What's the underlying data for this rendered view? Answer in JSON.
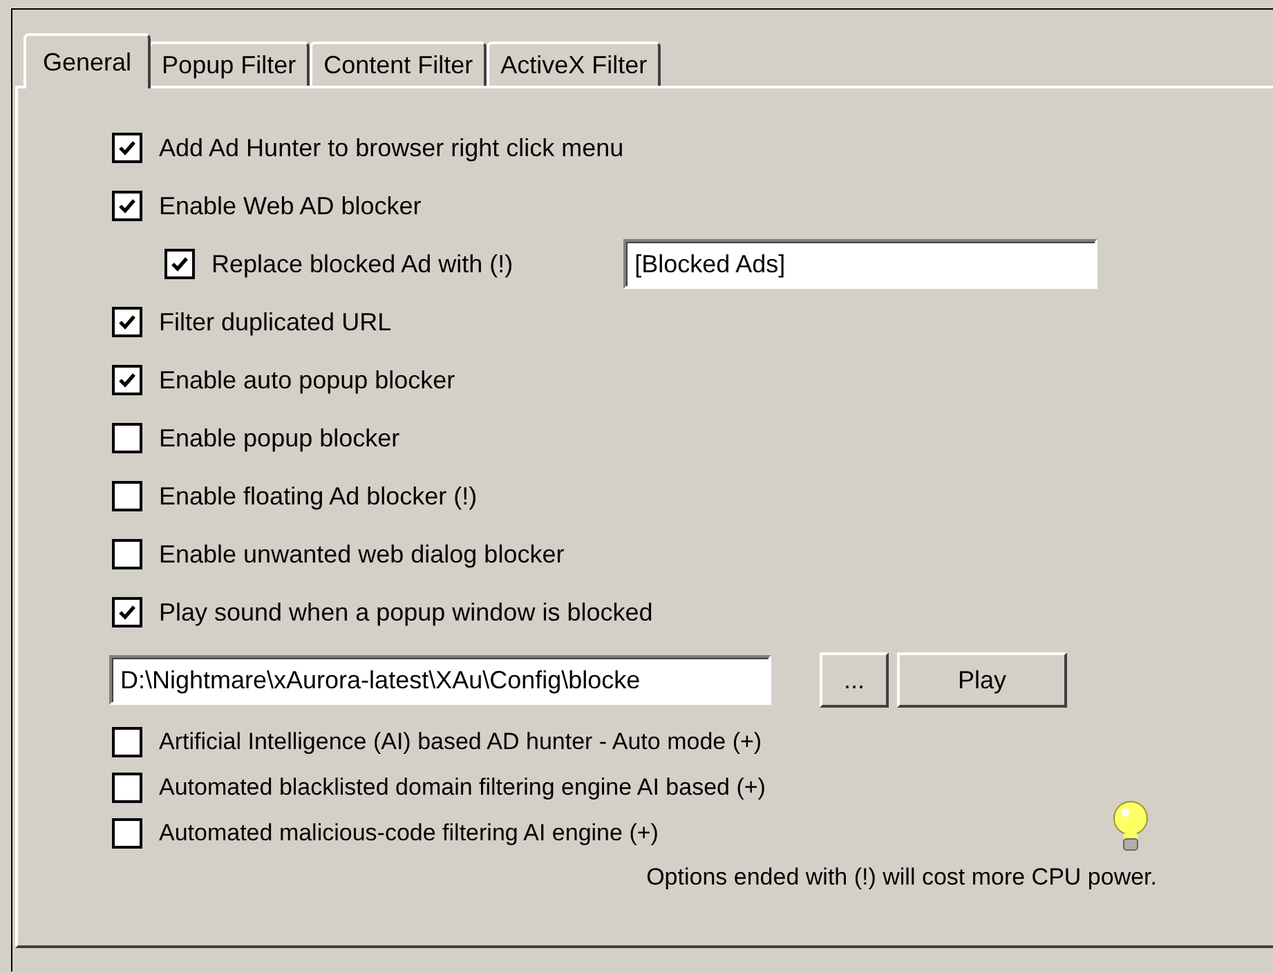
{
  "tabs": [
    {
      "label": "General",
      "selected": true
    },
    {
      "label": "Popup Filter",
      "selected": false
    },
    {
      "label": "Content Filter",
      "selected": false
    },
    {
      "label": "ActiveX Filter",
      "selected": false
    }
  ],
  "options": [
    {
      "kind": "check",
      "label": "Add Ad Hunter to browser right click menu",
      "checked": true
    },
    {
      "kind": "check",
      "label": "Enable Web AD blocker",
      "checked": true
    },
    {
      "kind": "check_field",
      "label": "Replace blocked Ad with (!)",
      "checked": true,
      "value": "[Blocked Ads]"
    },
    {
      "kind": "check",
      "label": "Filter duplicated URL",
      "checked": true
    },
    {
      "kind": "check",
      "label": "Enable auto popup blocker",
      "checked": true
    },
    {
      "kind": "check",
      "label": "Enable popup blocker",
      "checked": false
    },
    {
      "kind": "check",
      "label": "Enable floating Ad blocker (!)",
      "checked": false
    },
    {
      "kind": "check",
      "label": "Enable unwanted web dialog blocker",
      "checked": false
    },
    {
      "kind": "check",
      "label": "Play sound when a popup window is blocked",
      "checked": true
    },
    {
      "kind": "path",
      "value": "D:\\Nightmare\\xAurora-latest\\XAu\\Config\\blocke",
      "browse": "...",
      "play": "Play"
    },
    {
      "kind": "small_check",
      "label": "Artificial Intelligence (AI) based AD hunter - Auto mode (+)",
      "checked": false
    },
    {
      "kind": "small_check",
      "label": "Automated blacklisted domain filtering engine AI based (+)",
      "checked": false
    },
    {
      "kind": "small_check",
      "label": "Automated malicious-code filtering AI engine (+)",
      "checked": false
    }
  ],
  "note": "Options ended with (!) will cost more CPU power."
}
